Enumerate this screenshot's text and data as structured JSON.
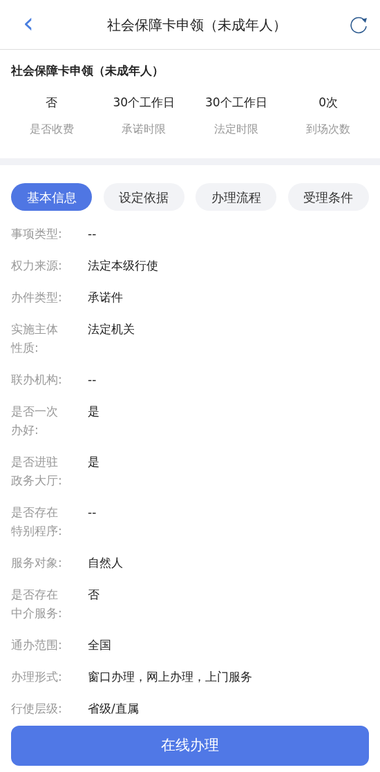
{
  "header": {
    "back_icon": "‹",
    "title": "社会保障卡申领（未成年人）"
  },
  "summary": {
    "title": "社会保障卡申领（未成年人）",
    "stats": [
      {
        "value": "否",
        "label": "是否收费"
      },
      {
        "value": "30个工作日",
        "label": "承诺时限"
      },
      {
        "value": "30个工作日",
        "label": "法定时限"
      },
      {
        "value": "0次",
        "label": "到场次数"
      }
    ]
  },
  "tabs": [
    {
      "label": "基本信息",
      "selected": true
    },
    {
      "label": "设定依据",
      "selected": false
    },
    {
      "label": "办理流程",
      "selected": false
    },
    {
      "label": "受理条件",
      "selected": false
    }
  ],
  "fields": [
    {
      "label": "事项类型:",
      "value": "--"
    },
    {
      "label": "权力来源:",
      "value": "法定本级行使"
    },
    {
      "label": "办件类型:",
      "value": "承诺件"
    },
    {
      "label": "实施主体性质:",
      "value": "法定机关"
    },
    {
      "label": "联办机构:",
      "value": "--"
    },
    {
      "label": "是否一次办好:",
      "value": "是"
    },
    {
      "label": "是否进驻政务大厅:",
      "value": "是"
    },
    {
      "label": "是否存在特别程序:",
      "value": "--"
    },
    {
      "label": "服务对象:",
      "value": "自然人"
    },
    {
      "label": "是否存在中介服务:",
      "value": "否"
    },
    {
      "label": "通办范围:",
      "value": "全国"
    },
    {
      "label": "办理形式:",
      "value": "窗口办理，网上办理，上门服务"
    },
    {
      "label": "行使层级:",
      "value": "省级/直属"
    }
  ],
  "action_button": "在线办理"
}
